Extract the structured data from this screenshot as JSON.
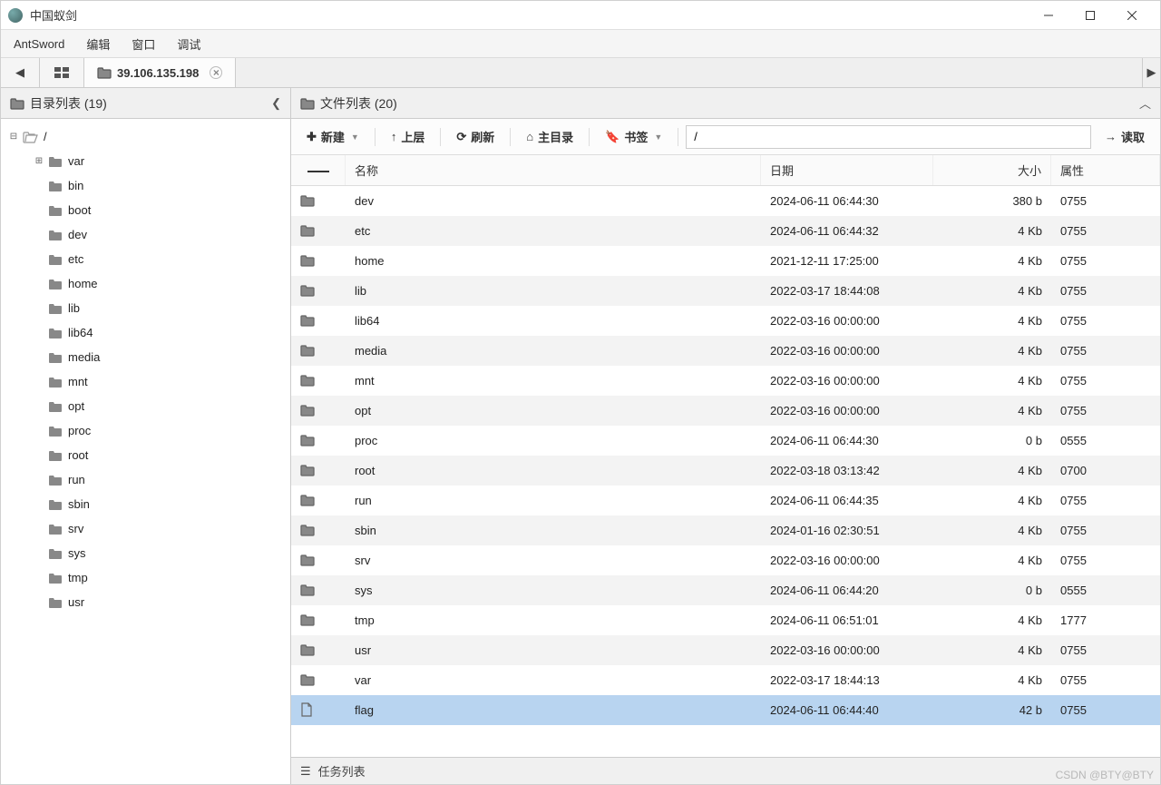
{
  "window": {
    "title": "中国蚁剑"
  },
  "menubar": {
    "app": "AntSword",
    "edit": "编辑",
    "window": "窗口",
    "debug": "调试"
  },
  "tabs": {
    "ip_label": "39.106.135.198"
  },
  "sidebar": {
    "title": "目录列表 (19)",
    "root": "/",
    "items": [
      "var",
      "bin",
      "boot",
      "dev",
      "etc",
      "home",
      "lib",
      "lib64",
      "media",
      "mnt",
      "opt",
      "proc",
      "root",
      "run",
      "sbin",
      "srv",
      "sys",
      "tmp",
      "usr"
    ]
  },
  "filepanel": {
    "title": "文件列表 (20)"
  },
  "toolbar": {
    "new": "新建",
    "up": "上层",
    "refresh": "刷新",
    "home": "主目录",
    "bookmark": "书签",
    "path": "/",
    "read": "读取"
  },
  "columns": {
    "name": "名称",
    "date": "日期",
    "size": "大小",
    "perm": "属性"
  },
  "files": [
    {
      "name": "dev",
      "date": "2024-06-11 06:44:30",
      "size": "380 b",
      "perm": "0755",
      "type": "dir"
    },
    {
      "name": "etc",
      "date": "2024-06-11 06:44:32",
      "size": "4 Kb",
      "perm": "0755",
      "type": "dir"
    },
    {
      "name": "home",
      "date": "2021-12-11 17:25:00",
      "size": "4 Kb",
      "perm": "0755",
      "type": "dir"
    },
    {
      "name": "lib",
      "date": "2022-03-17 18:44:08",
      "size": "4 Kb",
      "perm": "0755",
      "type": "dir"
    },
    {
      "name": "lib64",
      "date": "2022-03-16 00:00:00",
      "size": "4 Kb",
      "perm": "0755",
      "type": "dir"
    },
    {
      "name": "media",
      "date": "2022-03-16 00:00:00",
      "size": "4 Kb",
      "perm": "0755",
      "type": "dir"
    },
    {
      "name": "mnt",
      "date": "2022-03-16 00:00:00",
      "size": "4 Kb",
      "perm": "0755",
      "type": "dir"
    },
    {
      "name": "opt",
      "date": "2022-03-16 00:00:00",
      "size": "4 Kb",
      "perm": "0755",
      "type": "dir"
    },
    {
      "name": "proc",
      "date": "2024-06-11 06:44:30",
      "size": "0 b",
      "perm": "0555",
      "type": "dir"
    },
    {
      "name": "root",
      "date": "2022-03-18 03:13:42",
      "size": "4 Kb",
      "perm": "0700",
      "type": "dir"
    },
    {
      "name": "run",
      "date": "2024-06-11 06:44:35",
      "size": "4 Kb",
      "perm": "0755",
      "type": "dir"
    },
    {
      "name": "sbin",
      "date": "2024-01-16 02:30:51",
      "size": "4 Kb",
      "perm": "0755",
      "type": "dir"
    },
    {
      "name": "srv",
      "date": "2022-03-16 00:00:00",
      "size": "4 Kb",
      "perm": "0755",
      "type": "dir"
    },
    {
      "name": "sys",
      "date": "2024-06-11 06:44:20",
      "size": "0 b",
      "perm": "0555",
      "type": "dir"
    },
    {
      "name": "tmp",
      "date": "2024-06-11 06:51:01",
      "size": "4 Kb",
      "perm": "1777",
      "type": "dir"
    },
    {
      "name": "usr",
      "date": "2022-03-16 00:00:00",
      "size": "4 Kb",
      "perm": "0755",
      "type": "dir"
    },
    {
      "name": "var",
      "date": "2022-03-17 18:44:13",
      "size": "4 Kb",
      "perm": "0755",
      "type": "dir"
    },
    {
      "name": "flag",
      "date": "2024-06-11 06:44:40",
      "size": "42 b",
      "perm": "0755",
      "type": "file",
      "selected": true
    }
  ],
  "taskbar": {
    "label": "任务列表"
  },
  "watermark": "CSDN @BTY@BTY"
}
